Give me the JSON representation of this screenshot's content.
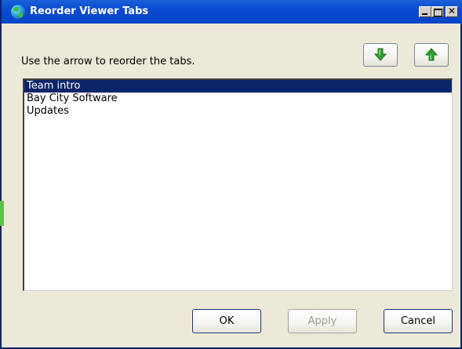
{
  "window": {
    "title": "Reorder Viewer Tabs",
    "icon": "globe-icon"
  },
  "titlebar_buttons": {
    "minimize": "minimize-icon",
    "maximize": "maximize-icon",
    "close_glyph": "✕"
  },
  "dialog": {
    "instruction": "Use the arrow to reorder the tabs.",
    "move_down_icon": "arrow-down-icon",
    "move_up_icon": "arrow-up-icon",
    "arrow_color": "#2ea02e"
  },
  "tabs_list": {
    "items": [
      {
        "label": "Team intro",
        "selected": true
      },
      {
        "label": "Bay City Software",
        "selected": false
      },
      {
        "label": "Updates",
        "selected": false
      }
    ]
  },
  "buttons": {
    "ok": "OK",
    "apply": "Apply",
    "apply_enabled": false,
    "cancel": "Cancel"
  },
  "colors": {
    "titlebar": "#0645c8",
    "selection": "#0a246a",
    "dialog_bg": "#ece9d8"
  }
}
